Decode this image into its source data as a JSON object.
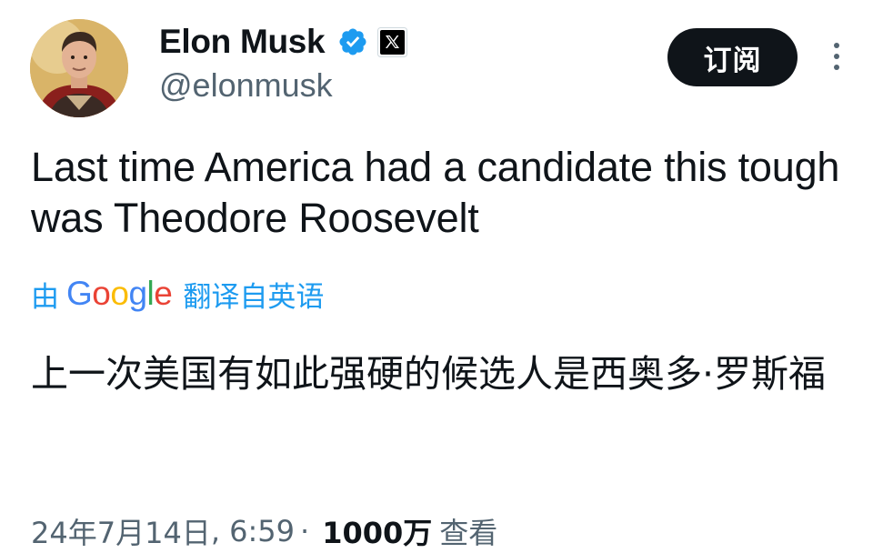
{
  "author": {
    "display_name": "Elon Musk",
    "handle": "@elonmusk",
    "verified_icon": "verified-badge-icon",
    "affiliate_icon": "x-logo-icon",
    "avatar_icon": "avatar"
  },
  "actions": {
    "subscribe_label": "订阅",
    "more_icon": "more-vertical-icon"
  },
  "tweet": {
    "text": "Last time America had a candidate this tough was Theodore Roosevelt"
  },
  "translation": {
    "prefix": "由",
    "provider_letters": [
      "G",
      "o",
      "o",
      "g",
      "l",
      "e"
    ],
    "suffix": "翻译自英语",
    "text": "上一次美国有如此强硬的候选人是西奥多·罗斯福"
  },
  "meta": {
    "date": "24年7月14日",
    "time": "6:59",
    "separator": "·",
    "views_count": "1000万",
    "views_label": "查看"
  },
  "colors": {
    "accent": "#1d9bf0",
    "text_primary": "#0f1419",
    "text_secondary": "#536471",
    "button_bg": "#0f1419"
  }
}
